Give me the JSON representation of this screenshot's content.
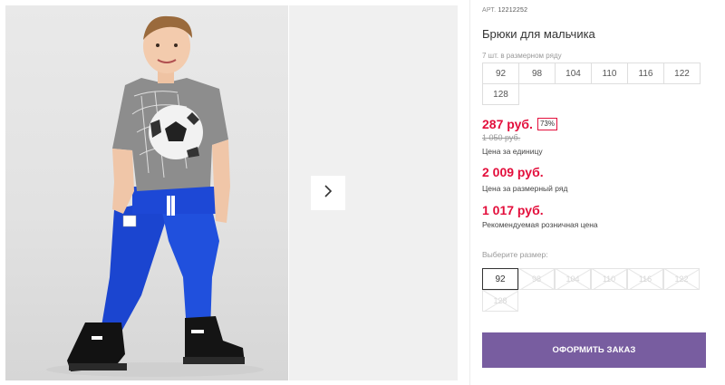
{
  "gallery": {
    "next_icon": "chevron-right-icon",
    "photo_alt": "boy in grey football t-shirt and blue pants"
  },
  "product": {
    "article_prefix": "АРТ.",
    "article_number": "12212252",
    "title": "Брюки для мальчика",
    "range_caption": "7 шт. в размерном ряду",
    "range_sizes": [
      "92",
      "98",
      "104",
      "110",
      "116",
      "122",
      "128"
    ]
  },
  "pricing": {
    "unit_price": "287 руб.",
    "discount": "73%",
    "old_price": "1 050 руб.",
    "unit_caption": "Цена за единицу",
    "range_price": "2 009 руб.",
    "range_caption": "Цена за размерный ряд",
    "retail_price": "1 017 руб.",
    "retail_caption": "Рекомендуемая розничная цена"
  },
  "size_choice": {
    "label": "Выберите размер:",
    "options": [
      "92",
      "98",
      "104",
      "110",
      "116",
      "122",
      "128"
    ],
    "selected": "92"
  },
  "actions": {
    "order_label": "ОФОРМИТЬ ЗАКАЗ"
  },
  "colors": {
    "price_red": "#e30f3c",
    "button_purple": "#785da0",
    "pants_blue": "#1b45d0"
  }
}
